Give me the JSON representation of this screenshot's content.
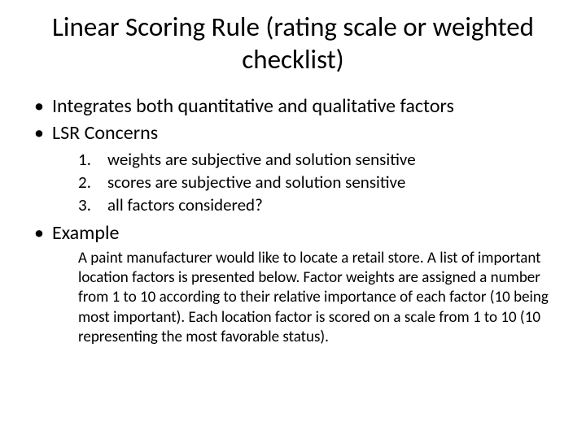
{
  "title": "Linear Scoring Rule (rating scale or weighted checklist)",
  "bullets": {
    "b1": "Integrates both quantitative and qualitative factors",
    "b2": "LSR Concerns",
    "b3": "Example"
  },
  "concerns": {
    "c1": "weights are subjective and solution sensitive",
    "c2": "scores are subjective and solution sensitive",
    "c3": "all factors considered?"
  },
  "example_text": "A paint manufacturer would like to locate a retail store. A list of important location factors is presented below. Factor weights are assigned a number from 1 to 10 according to their relative importance of each factor (10 being most important). Each location factor is scored on a scale from 1 to 10 (10 representing the most favorable status)."
}
